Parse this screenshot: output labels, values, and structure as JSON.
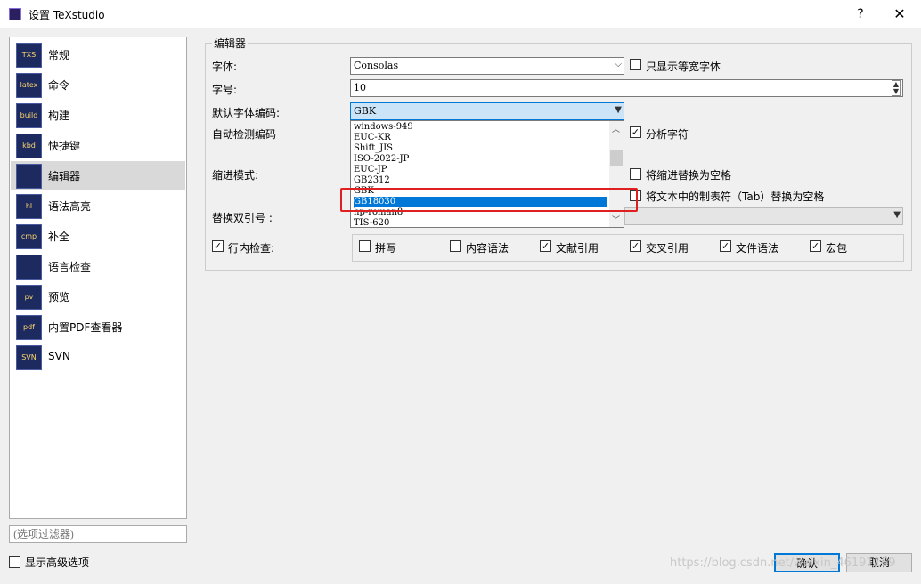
{
  "window": {
    "title": "设置 TeXstudio",
    "help_label": "?",
    "close_label": "✕"
  },
  "categories": [
    {
      "label": "常规",
      "icon": "TXS"
    },
    {
      "label": "命令",
      "icon": "latex"
    },
    {
      "label": "构建",
      "icon": "build"
    },
    {
      "label": "快捷键",
      "icon": "kbd"
    },
    {
      "label": "编辑器",
      "icon": "I"
    },
    {
      "label": "语法高亮",
      "icon": "hl"
    },
    {
      "label": "补全",
      "icon": "cmp"
    },
    {
      "label": "语言检查",
      "icon": "I"
    },
    {
      "label": "预览",
      "icon": "pv"
    },
    {
      "label": "内置PDF查看器",
      "icon": "pdf"
    },
    {
      "label": "SVN",
      "icon": "SVN"
    }
  ],
  "selected_category": "编辑器",
  "filter_placeholder": "(选项过滤器)",
  "advanced_label": "显示高级选项",
  "editor": {
    "group_title": "编辑器",
    "font_label": "字体:",
    "font_value": "Consolas",
    "mono_only_label": "只显示等宽字体",
    "size_label": "字号:",
    "size_value": "10",
    "encoding_label": "默认字体编码:",
    "encoding_value": "GBK",
    "autodetect_label": "自动检测编码",
    "analyze_label": "分析字符",
    "indent_label": "缩进模式:",
    "tab_to_space_label": "将缩进替换为空格",
    "replace_tab_label": "将文本中的制表符（Tab）替换为空格",
    "quotes_label": "替换双引号 :",
    "inline_check_label": "行内检查:",
    "checks": [
      {
        "label": "拼写",
        "checked": false
      },
      {
        "label": "内容语法",
        "checked": false
      },
      {
        "label": "文献引用",
        "checked": true
      },
      {
        "label": "交叉引用",
        "checked": true
      },
      {
        "label": "文件语法",
        "checked": true
      },
      {
        "label": "宏包",
        "checked": true
      }
    ]
  },
  "encoding_options": [
    "windows-949",
    "EUC-KR",
    "Shift_JIS",
    "ISO-2022-JP",
    "EUC-JP",
    "GB2312",
    "GBK",
    "GB18030",
    "hp-roman8",
    "TIS-620"
  ],
  "encoding_highlighted": "GB18030",
  "buttons": {
    "ok": "确认",
    "cancel": "取消"
  },
  "watermark": "https://blog.csdn.net/weixin_46191169",
  "colors": {
    "highlight": "#0078d7",
    "red_box": "#e02020"
  }
}
